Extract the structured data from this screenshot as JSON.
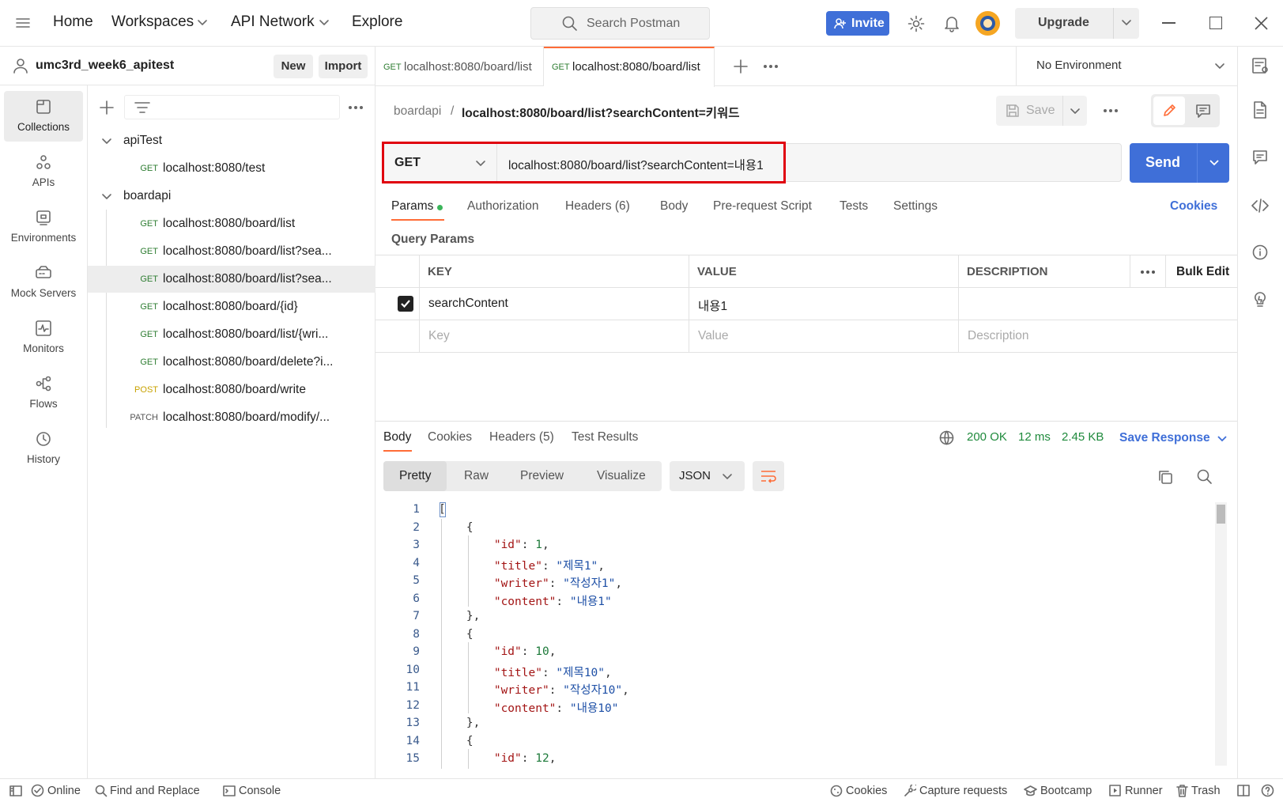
{
  "topbar": {
    "home": "Home",
    "workspaces": "Workspaces",
    "api_network": "API Network",
    "explore": "Explore",
    "search_placeholder": "Search Postman",
    "invite": "Invite",
    "upgrade": "Upgrade"
  },
  "workspace": {
    "name": "umc3rd_week6_apitest",
    "new": "New",
    "import": "Import"
  },
  "rail": [
    {
      "label": "Collections",
      "icon": "collections-icon"
    },
    {
      "label": "APIs",
      "icon": "apis-icon"
    },
    {
      "label": "Environments",
      "icon": "environments-icon"
    },
    {
      "label": "Mock Servers",
      "icon": "mock-servers-icon"
    },
    {
      "label": "Monitors",
      "icon": "monitors-icon"
    },
    {
      "label": "Flows",
      "icon": "flows-icon"
    },
    {
      "label": "History",
      "icon": "history-icon"
    }
  ],
  "collections": [
    {
      "name": "apiTest",
      "requests": [
        {
          "method": "GET",
          "url": "localhost:8080/test"
        }
      ]
    },
    {
      "name": "boardapi",
      "requests": [
        {
          "method": "GET",
          "url": "localhost:8080/board/list"
        },
        {
          "method": "GET",
          "url": "localhost:8080/board/list?sea..."
        },
        {
          "method": "GET",
          "url": "localhost:8080/board/list?sea..."
        },
        {
          "method": "GET",
          "url": "localhost:8080/board/{id}"
        },
        {
          "method": "GET",
          "url": "localhost:8080/board/list/{wri..."
        },
        {
          "method": "GET",
          "url": "localhost:8080/board/delete?i..."
        },
        {
          "method": "POST",
          "url": "localhost:8080/board/write"
        },
        {
          "method": "PATCH",
          "url": "localhost:8080/board/modify/..."
        }
      ]
    }
  ],
  "tabs": [
    {
      "method": "GET",
      "title": "localhost:8080/board/list"
    },
    {
      "method": "GET",
      "title": "localhost:8080/board/list"
    }
  ],
  "environment": "No Environment",
  "request": {
    "breadcrumb_collection": "boardapi",
    "breadcrumb_sep": "/",
    "name": "localhost:8080/board/list?searchContent=키워드",
    "save": "Save",
    "method": "GET",
    "url": "localhost:8080/board/list?searchContent=내용1",
    "send": "Send",
    "subtabs": [
      "Params",
      "Authorization",
      "Headers (6)",
      "Body",
      "Pre-request Script",
      "Tests",
      "Settings"
    ],
    "cookies": "Cookies",
    "query_params_title": "Query Params",
    "table_headers": [
      "KEY",
      "VALUE",
      "DESCRIPTION"
    ],
    "bulk_edit": "Bulk Edit",
    "params": [
      {
        "key": "searchContent",
        "value": "내용1",
        "description": ""
      }
    ],
    "placeholder_row": {
      "key": "Key",
      "value": "Value",
      "description": "Description"
    }
  },
  "response": {
    "tabs": [
      "Body",
      "Cookies",
      "Headers (5)",
      "Test Results"
    ],
    "status": "200 OK",
    "time": "12 ms",
    "size": "2.45 KB",
    "save_response": "Save Response",
    "view_modes": [
      "Pretty",
      "Raw",
      "Preview",
      "Visualize"
    ],
    "format": "JSON",
    "lines": [
      {
        "n": "1",
        "code": "["
      },
      {
        "n": "2",
        "code": "    {"
      },
      {
        "n": "3",
        "code": "        \"id\": 1,"
      },
      {
        "n": "4",
        "code": "        \"title\": \"제목1\","
      },
      {
        "n": "5",
        "code": "        \"writer\": \"작성자1\","
      },
      {
        "n": "6",
        "code": "        \"content\": \"내용1\""
      },
      {
        "n": "7",
        "code": "    },"
      },
      {
        "n": "8",
        "code": "    {"
      },
      {
        "n": "9",
        "code": "        \"id\": 10,"
      },
      {
        "n": "10",
        "code": "        \"title\": \"제목10\","
      },
      {
        "n": "11",
        "code": "        \"writer\": \"작성자10\","
      },
      {
        "n": "12",
        "code": "        \"content\": \"내용10\""
      },
      {
        "n": "13",
        "code": "    },"
      },
      {
        "n": "14",
        "code": "    {"
      },
      {
        "n": "15",
        "code": "        \"id\": 12,"
      }
    ]
  },
  "bottombar": {
    "online": "Online",
    "find_replace": "Find and Replace",
    "console": "Console",
    "cookies": "Cookies",
    "capture": "Capture requests",
    "bootcamp": "Bootcamp",
    "runner": "Runner",
    "trash": "Trash"
  },
  "colors": {
    "accent": "#ff6c37",
    "primary": "#3f6fd8",
    "get": "#2e7d32",
    "post": "#c8a200",
    "highlight_box": "#e0000f"
  }
}
